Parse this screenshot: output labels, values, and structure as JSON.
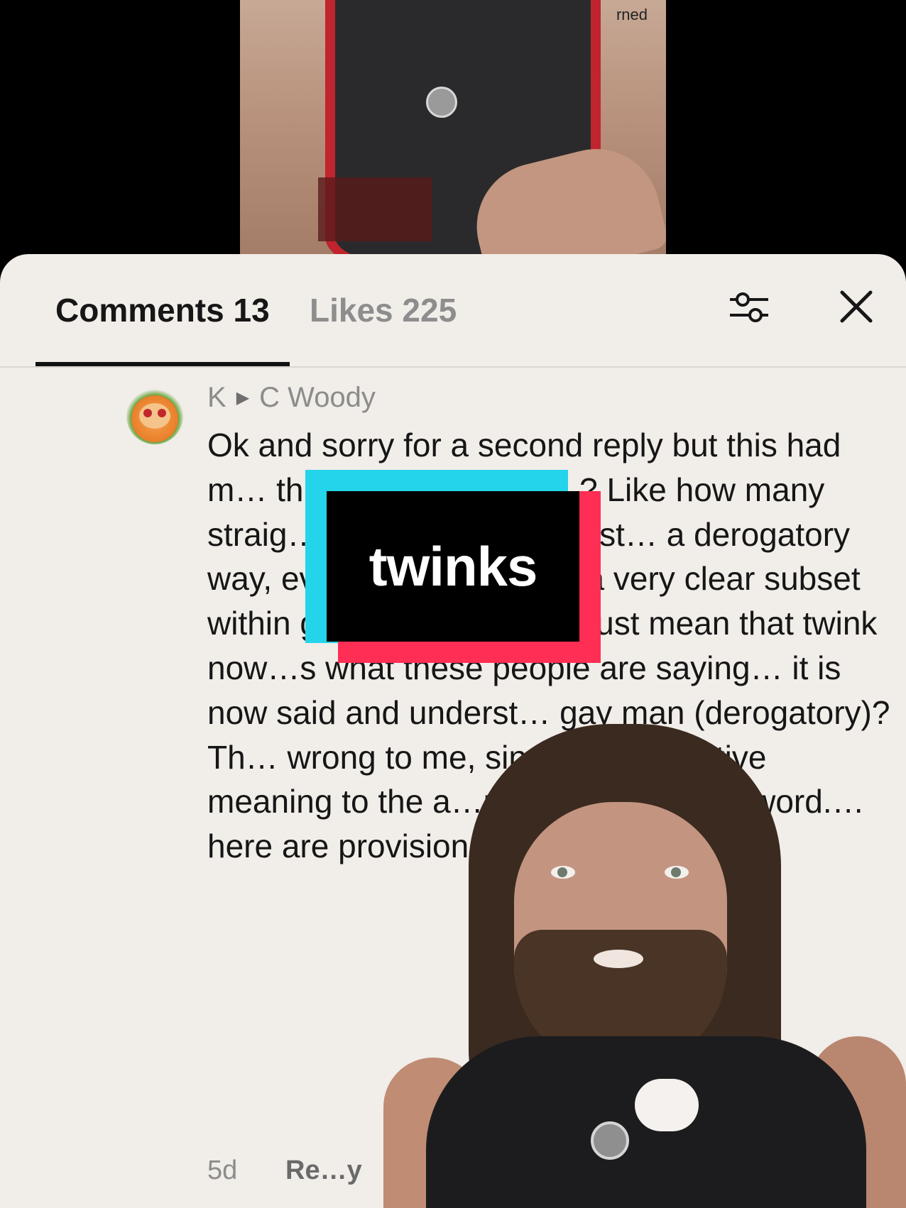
{
  "video_top": {
    "caption_fragment": "rned"
  },
  "tabs": {
    "comments_label": "Comments 13",
    "likes_label": "Likes 225"
  },
  "icons": {
    "filter": "filter-sliders-icon",
    "close": "close-icon"
  },
  "comment": {
    "author": "K",
    "reply_to": "C Woody",
    "text": "Ok and sorry for a second reply but this had m… this apply to definit…? Like how many straig… saying “twink” to just… a derogatory way, even though twink is a very clear subset within gay men. Does this just mean that twink now…s what these people are saying… it is now said and underst… gay man (derogatory)? Th… wrong to me, since it has…ective meaning to the a…nity that made the word.…here are provisions fo…ss I’m misund",
    "time": "5d",
    "reply_label": "Re…y"
  },
  "sticker": {
    "text": "twinks"
  },
  "colors": {
    "sheet_bg": "#f1ede9",
    "sticker_cyan": "#24d4ea",
    "sticker_red": "#ff2e55",
    "tab_active": "#161616",
    "tab_inactive": "#8d8d8d"
  }
}
